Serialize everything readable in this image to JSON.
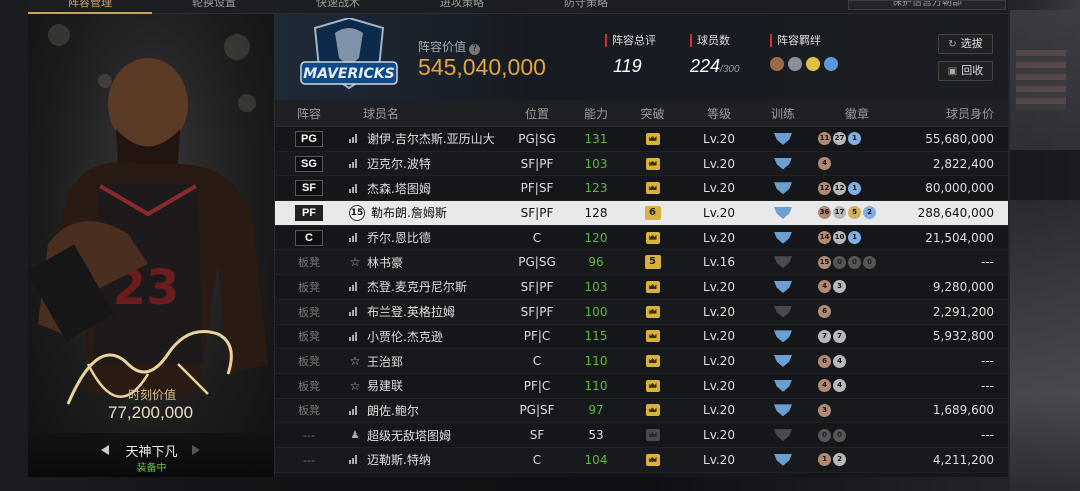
{
  "tabs": [
    "阵容管理",
    "轮换设置",
    "快速战术",
    "进攻策略",
    "防守策略"
  ],
  "tab_right": "保护信营方朝部",
  "card": {
    "value_label": "时刻价值",
    "value": "77,200,000",
    "name": "天神下凡",
    "status": "装备中"
  },
  "header": {
    "lineup_value_label": "阵容价值",
    "lineup_value": "545,040,000",
    "rating_label": "阵容总评",
    "rating": "119",
    "count_label": "球员数",
    "count": "224",
    "count_max": "/300",
    "bonds_label": "阵容羁绊",
    "btn_select": "选拔",
    "btn_recycle": "回收"
  },
  "columns": [
    "阵容",
    "球员名",
    "位置",
    "能力",
    "突破",
    "等级",
    "训练",
    "徽章",
    "球员身价"
  ],
  "colors": {
    "accent": "#c9a25a",
    "value": "#e3a53c",
    "green": "#5fb83a",
    "gold": "#d8b23a"
  },
  "rows": [
    {
      "pos": "PG",
      "name": "谢伊.吉尔杰斯.亚历山大",
      "position": "PG|SG",
      "ability": "131",
      "brk": "",
      "level": "Lv.20",
      "badges": [
        [
          "b",
          "11"
        ],
        [
          "s",
          "27"
        ],
        [
          "h",
          "1"
        ]
      ],
      "value": "55,680,000"
    },
    {
      "pos": "SG",
      "name": "迈克尔.波特",
      "position": "SF|PF",
      "ability": "103",
      "brk": "",
      "level": "Lv.20",
      "badges": [
        [
          "b",
          "4"
        ]
      ],
      "value": "2,822,400"
    },
    {
      "pos": "SF",
      "name": "杰森.塔图姆",
      "position": "PF|SF",
      "ability": "123",
      "brk": "",
      "level": "Lv.20",
      "badges": [
        [
          "b",
          "12"
        ],
        [
          "s",
          "12"
        ],
        [
          "h",
          "1"
        ]
      ],
      "value": "80,000,000"
    },
    {
      "pos": "PF",
      "name": "勒布朗.詹姆斯",
      "num": "15",
      "position": "SF|PF",
      "ability": "128",
      "brk": "6",
      "level": "Lv.20",
      "badges": [
        [
          "b",
          "36"
        ],
        [
          "s",
          "17"
        ],
        [
          "g",
          "5"
        ],
        [
          "h",
          "2"
        ]
      ],
      "value": "288,640,000",
      "sel": true
    },
    {
      "pos": "C",
      "name": "乔尔.恩比德",
      "position": "C",
      "ability": "120",
      "brk": "",
      "level": "Lv.20",
      "badges": [
        [
          "b",
          "14"
        ],
        [
          "s",
          "10"
        ],
        [
          "h",
          "1"
        ]
      ],
      "value": "21,504,000"
    },
    {
      "pos": "板凳",
      "name": "林书豪",
      "icon": "star",
      "position": "PG|SG",
      "ability": "96",
      "brk": "5",
      "level": "Lv.16",
      "train": "dim",
      "badges": [
        [
          "b",
          "15"
        ],
        [
          "z",
          "0"
        ],
        [
          "z",
          "0"
        ],
        [
          "z",
          "0"
        ]
      ],
      "value": "---"
    },
    {
      "pos": "板凳",
      "name": "杰登.麦克丹尼尔斯",
      "position": "SF|PF",
      "ability": "103",
      "brk": "",
      "level": "Lv.20",
      "badges": [
        [
          "b",
          "4"
        ],
        [
          "s",
          "3"
        ]
      ],
      "value": "9,280,000"
    },
    {
      "pos": "板凳",
      "name": "布兰登.英格拉姆",
      "position": "SF|PF",
      "ability": "100",
      "brk": "",
      "level": "Lv.20",
      "train": "dim",
      "badges": [
        [
          "b",
          "6"
        ]
      ],
      "value": "2,291,200"
    },
    {
      "pos": "板凳",
      "name": "小贾伦.杰克逊",
      "position": "PF|C",
      "ability": "115",
      "brk": "",
      "level": "Lv.20",
      "badges": [
        [
          "s",
          "7"
        ],
        [
          "s",
          "7"
        ]
      ],
      "value": "5,932,800"
    },
    {
      "pos": "板凳",
      "name": "王治郅",
      "icon": "star",
      "position": "C",
      "ability": "110",
      "brk": "",
      "level": "Lv.20",
      "badges": [
        [
          "b",
          "6"
        ],
        [
          "s",
          "4"
        ]
      ],
      "value": "---"
    },
    {
      "pos": "板凳",
      "name": "易建联",
      "icon": "star",
      "position": "PF|C",
      "ability": "110",
      "brk": "",
      "level": "Lv.20",
      "badges": [
        [
          "b",
          "4"
        ],
        [
          "s",
          "4"
        ]
      ],
      "value": "---"
    },
    {
      "pos": "板凳",
      "name": "朗佐.鲍尔",
      "position": "PG|SF",
      "ability": "97",
      "brk": "",
      "level": "Lv.20",
      "badges": [
        [
          "b",
          "3"
        ]
      ],
      "value": "1,689,600"
    },
    {
      "pos": "---",
      "name": "超级无敌塔图姆",
      "icon": "person",
      "position": "SF",
      "ability": "53",
      "abilityWhite": true,
      "brk": "dim",
      "level": "Lv.20",
      "train": "dim",
      "badges": [
        [
          "z",
          "0"
        ],
        [
          "z",
          "0"
        ]
      ],
      "value": "---"
    },
    {
      "pos": "---",
      "name": "迈勒斯.特纳",
      "position": "C",
      "ability": "104",
      "brk": "",
      "level": "Lv.20",
      "badges": [
        [
          "b",
          "1"
        ],
        [
          "s",
          "2"
        ]
      ],
      "value": "4,211,200"
    }
  ]
}
